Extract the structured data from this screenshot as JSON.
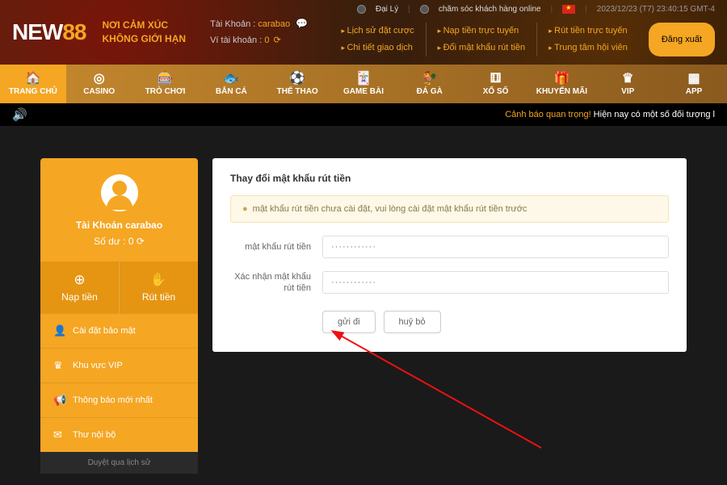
{
  "logo": {
    "pre": "NEW",
    "accent": "88"
  },
  "tagline": {
    "l1": "NƠI CẢM XÚC",
    "l2": "KHÔNG GIỚI HẠN"
  },
  "account": {
    "label": "Tài Khoản :",
    "name": "carabao",
    "wallet_label": "Ví tài khoản :",
    "wallet_value": "0"
  },
  "top": {
    "agent": "Đại Lý",
    "cs": "chăm sóc khách hàng online",
    "timestamp": "2023/12/23 (T7) 23:40:15 GMT-4"
  },
  "links": {
    "c1a": "Lịch sử đặt cược",
    "c1b": "Chi tiết giao dịch",
    "c2a": "Nạp tiền trực tuyến",
    "c2b": "Đổi mật khẩu rút tiền",
    "c3a": "Rút tiền trực tuyến",
    "c3b": "Trung tâm hội viên"
  },
  "logout": "Đăng xuất",
  "nav": [
    {
      "label": "TRANG CHỦ",
      "icon": "🏠"
    },
    {
      "label": "CASINO",
      "icon": "◎"
    },
    {
      "label": "TRÒ CHƠI",
      "icon": "🎰"
    },
    {
      "label": "BẮN CÁ",
      "icon": "🐟"
    },
    {
      "label": "THỂ THAO",
      "icon": "⚽"
    },
    {
      "label": "GAME BÀI",
      "icon": "🃏"
    },
    {
      "label": "ĐÁ GÀ",
      "icon": "🐓"
    },
    {
      "label": "XỔ SỐ",
      "icon": "⚅"
    },
    {
      "label": "KHUYẾN MÃI",
      "icon": "🎁"
    },
    {
      "label": "VIP",
      "icon": "♛"
    },
    {
      "label": "APP",
      "icon": "▦"
    }
  ],
  "marquee": {
    "alert": "Cảnh báo quan trọng!",
    "text": "  Hiện nay có một số đối tượng l"
  },
  "profile": {
    "title_prefix": "Tài Khoản ",
    "name": "carabao",
    "balance_prefix": "Số dư : ",
    "balance": "0"
  },
  "actions": {
    "deposit": "Nạp tiền",
    "withdraw": "Rút tiền"
  },
  "menu": {
    "security": "Cài đặt bảo mật",
    "vip": "Khu vực VIP",
    "news": "Thông báo mới nhất",
    "inbox": "Thư nội bộ",
    "history": "Duyệt qua lịch sử"
  },
  "panel": {
    "title": "Thay đổi mật khẩu rút tiền",
    "alert": "mật khẩu rút tiền chưa cài đặt, vui lòng cài đặt mật khẩu rút tiền trước",
    "label1": "mật khẩu rút tiền",
    "label2": "Xác nhận mật khẩu rút tiền",
    "placeholder": "············",
    "submit": "gửi đi",
    "cancel": "huỷ bỏ"
  }
}
